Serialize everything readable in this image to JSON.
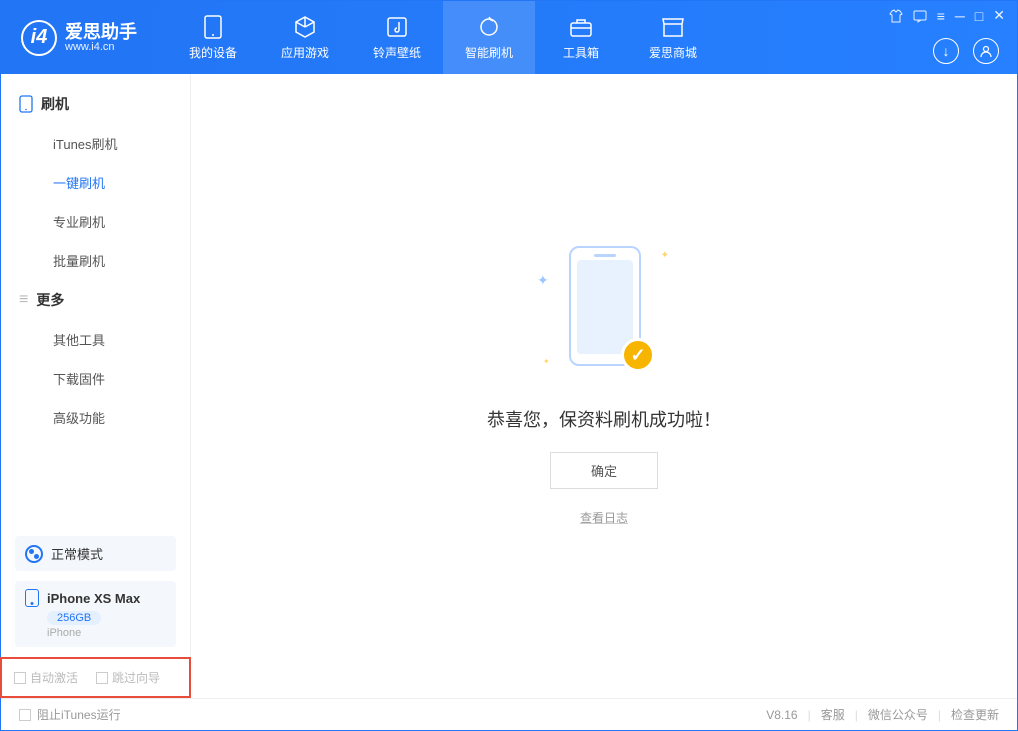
{
  "app": {
    "name": "爱思助手",
    "site": "www.i4.cn"
  },
  "nav": [
    {
      "label": "我的设备",
      "icon": "device"
    },
    {
      "label": "应用游戏",
      "icon": "cube"
    },
    {
      "label": "铃声壁纸",
      "icon": "music"
    },
    {
      "label": "智能刷机",
      "icon": "refresh",
      "active": true
    },
    {
      "label": "工具箱",
      "icon": "toolbox"
    },
    {
      "label": "爱思商城",
      "icon": "shop"
    }
  ],
  "sidebar": {
    "group1": {
      "title": "刷机",
      "items": [
        "iTunes刷机",
        "一键刷机",
        "专业刷机",
        "批量刷机"
      ],
      "activeIndex": 1
    },
    "group2": {
      "title": "更多",
      "items": [
        "其他工具",
        "下载固件",
        "高级功能"
      ]
    }
  },
  "device": {
    "mode": "正常模式",
    "name": "iPhone XS Max",
    "storage": "256GB",
    "type": "iPhone"
  },
  "options": {
    "autoActivate": "自动激活",
    "skipGuide": "跳过向导"
  },
  "main": {
    "successText": "恭喜您，保资料刷机成功啦！",
    "okButton": "确定",
    "viewLog": "查看日志"
  },
  "footer": {
    "blockItunes": "阻止iTunes运行",
    "version": "V8.16",
    "links": [
      "客服",
      "微信公众号",
      "检查更新"
    ]
  }
}
